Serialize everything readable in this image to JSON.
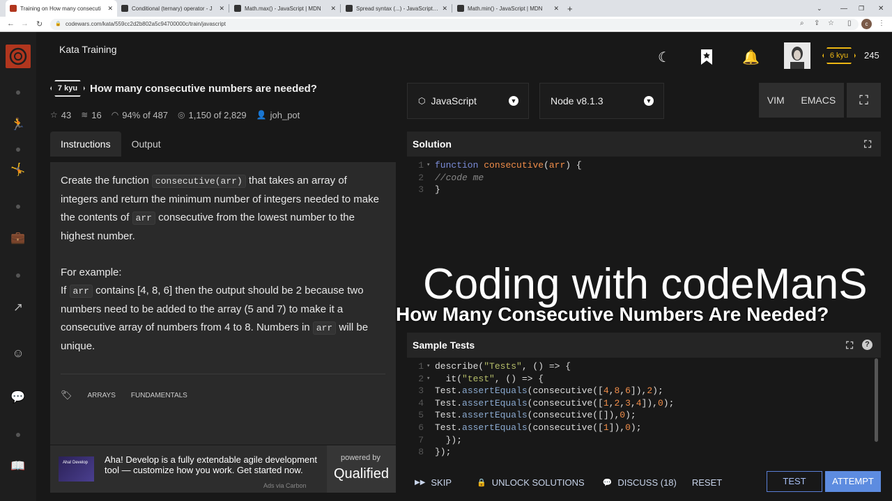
{
  "browser": {
    "tabs": [
      {
        "title": "Training on How many consecuti"
      },
      {
        "title": "Conditional (ternary) operator - J"
      },
      {
        "title": "Math.max() - JavaScript | MDN"
      },
      {
        "title": "Spread syntax (...) - JavaScript | M"
      },
      {
        "title": "Math.min() - JavaScript | MDN"
      }
    ],
    "new_tab": "+",
    "url": "codewars.com/kata/559cc2d2b802a5c94700000c/train/javascript"
  },
  "header": {
    "title": "Kata Training",
    "rank": "6 kyu",
    "honor": "245"
  },
  "kata": {
    "kyu": "7 kyu",
    "name": "How many consecutive numbers are needed?",
    "stats": {
      "stars": "43",
      "collections": "16",
      "satisfaction": "94% of 487",
      "completed": "1,150 of 2,829",
      "author": "joh_pot"
    },
    "tabs": {
      "instructions": "Instructions",
      "output": "Output"
    },
    "description": {
      "p1_a": "Create the function ",
      "p1_code": "consecutive(arr)",
      "p1_b": " that takes an array of integers and return the minimum number of integers needed to make the contents of ",
      "p1_code2": "arr",
      "p1_c": " consecutive from the lowest number to the highest number.",
      "p2_a": "For example:",
      "p2_b": "If ",
      "p2_code": "arr",
      "p2_c": " contains [4, 8, 6] then the output should be 2 because two numbers need to be added to the array (5 and 7) to make it a consecutive array of numbers from 4 to 8. Numbers in ",
      "p2_code2": "arr",
      "p2_d": " will be unique."
    },
    "tags": [
      "ARRAYS",
      "FUNDAMENTALS"
    ]
  },
  "ad": {
    "logo": "Aha! Develop",
    "text": "Aha! Develop is a fully extendable agile development tool — customize how you work. Get started now.",
    "source": "Ads via Carbon",
    "powered_by": "powered by",
    "brand": "Qualified"
  },
  "editor": {
    "language": "JavaScript",
    "runtime": "Node v8.1.3",
    "vim": "VIM",
    "emacs": "EMACS",
    "solution_title": "Solution",
    "tests_title": "Sample Tests"
  },
  "overlay": {
    "line1": "Coding with codeManS",
    "line2": "How Many Consecutive Numbers Are Needed?"
  },
  "footer": {
    "skip": "SKIP",
    "unlock": "UNLOCK SOLUTIONS",
    "discuss": "DISCUSS (18)",
    "reset": "RESET",
    "test": "TEST",
    "attempt": "ATTEMPT"
  },
  "colors": {
    "brand": "#b1361e",
    "rank": "#ecb613",
    "accent": "#5d8ce0"
  }
}
